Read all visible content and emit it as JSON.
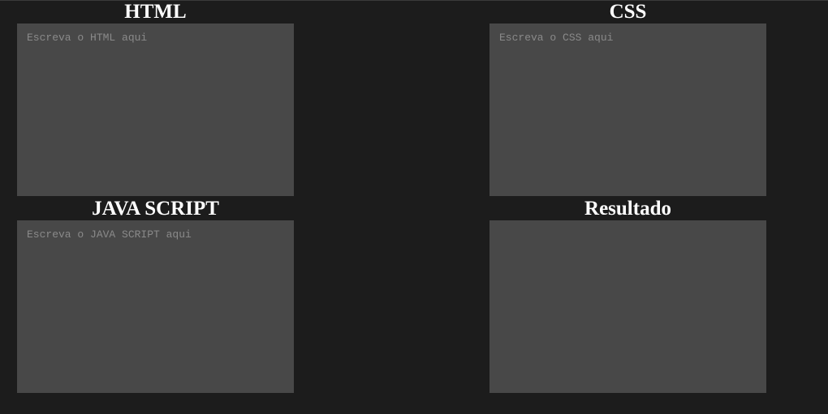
{
  "panels": {
    "html": {
      "title": "HTML",
      "placeholder": "Escreva o HTML aqui",
      "value": ""
    },
    "css": {
      "title": "CSS",
      "placeholder": "Escreva o CSS aqui",
      "value": ""
    },
    "js": {
      "title": "JAVA SCRIPT",
      "placeholder": "Escreva o JAVA SCRIPT aqui",
      "value": ""
    },
    "result": {
      "title": "Resultado"
    }
  },
  "colors": {
    "background": "#1c1c1c",
    "editor_background": "#484848",
    "title_text": "#ffffff",
    "placeholder_text": "#8a8a8a"
  }
}
